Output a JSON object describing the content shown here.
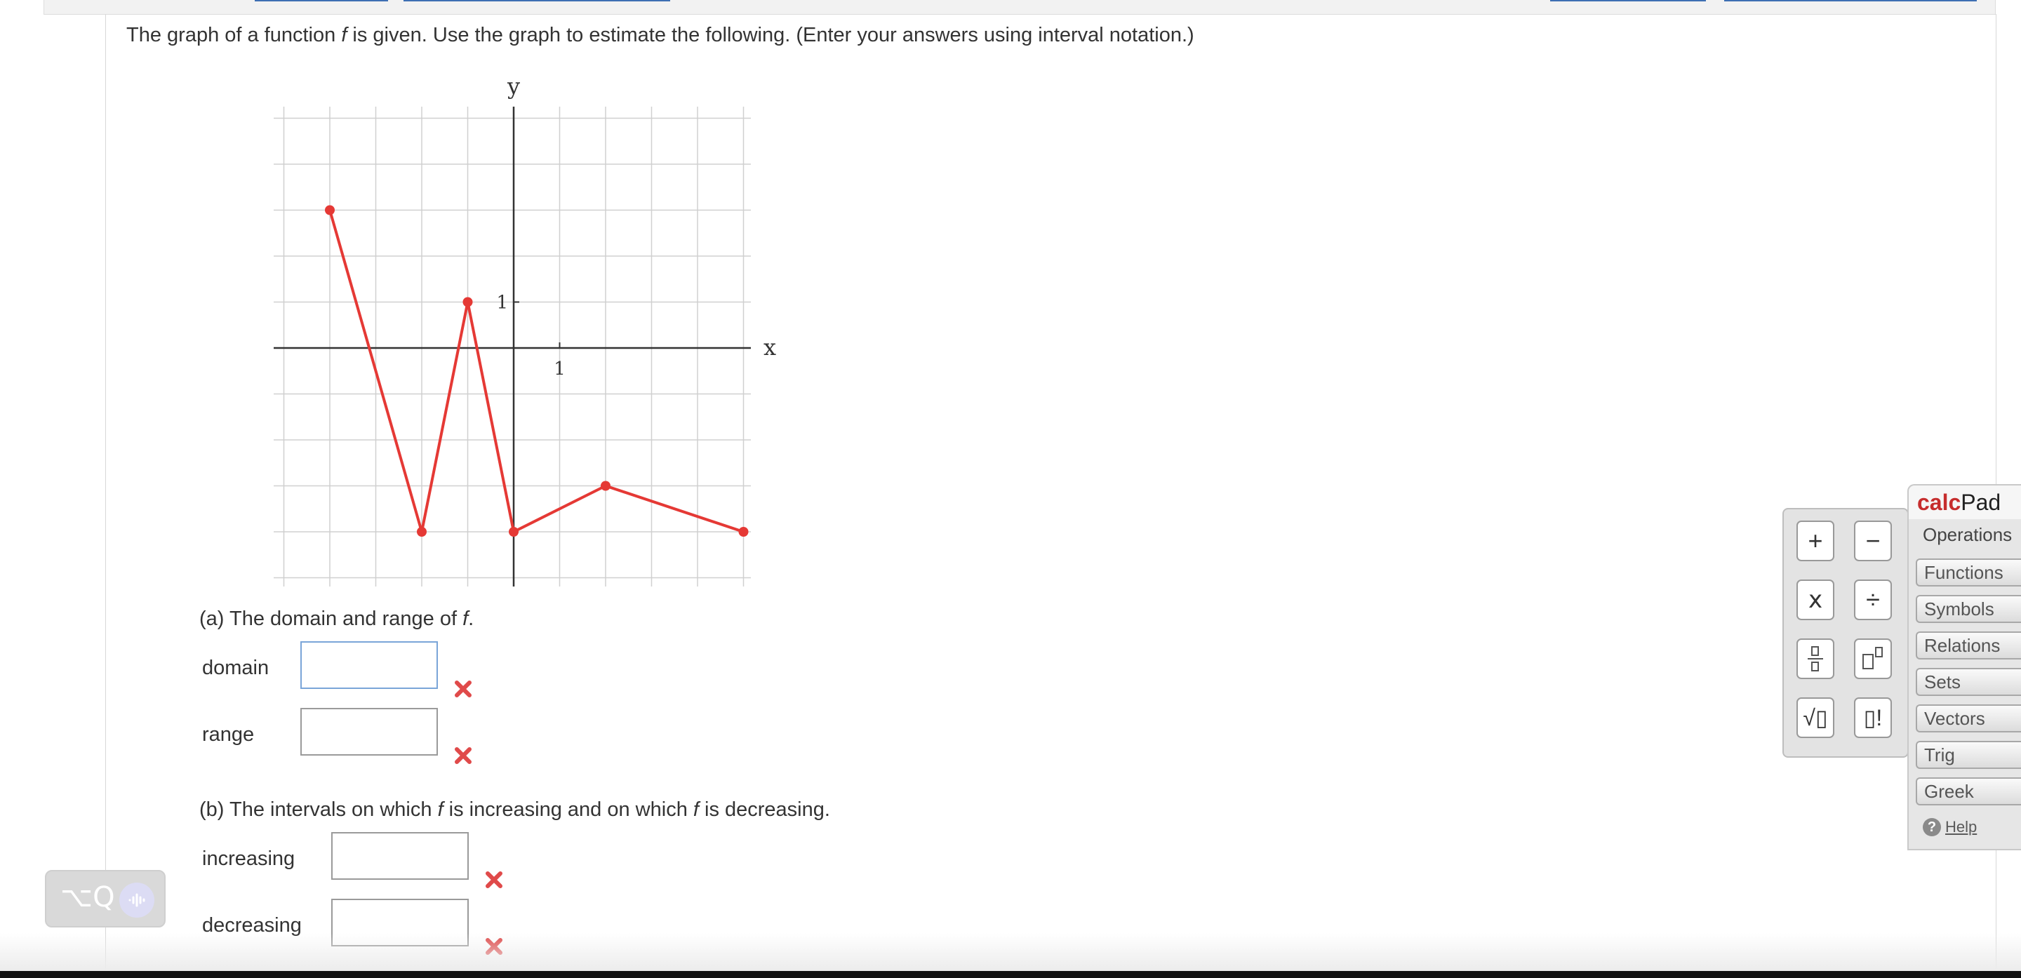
{
  "question": {
    "part1": "The graph of a function ",
    "f": "f",
    "part2": " is given. Use the graph to estimate the following. (Enter your answers using interval notation.)"
  },
  "graph": {
    "x_axis_label": "x",
    "y_axis_label": "y",
    "x_tick_label": "1",
    "y_tick_label": "1",
    "curve_color": "#e53935",
    "points": [
      [
        -4,
        3
      ],
      [
        -2,
        -4
      ],
      [
        -1,
        1
      ],
      [
        0,
        -4
      ],
      [
        2,
        -3
      ],
      [
        5,
        -4
      ]
    ],
    "closed_dots": [
      [
        -4,
        3
      ],
      [
        -2,
        -4
      ],
      [
        -1,
        1
      ],
      [
        0,
        -4
      ],
      [
        2,
        -3
      ],
      [
        5,
        -4
      ]
    ],
    "x_range": [
      -5,
      5
    ],
    "y_range": [
      -5,
      5
    ],
    "grid": true
  },
  "part_a": {
    "prefix": "(a) The domain and range of ",
    "f": "f",
    "suffix": ".",
    "domain_label": "domain",
    "range_label": "range",
    "domain_value": "",
    "range_value": ""
  },
  "part_b": {
    "prefix": "(b) The intervals on which ",
    "f1": "f",
    "middle": " is increasing and on which ",
    "f2": "f",
    "suffix": " is decreasing.",
    "increasing_label": "increasing",
    "decreasing_label": "decreasing",
    "increasing_value": "",
    "decreasing_value": ""
  },
  "status": {
    "wrong_icon": "x-mark-icon",
    "wrong_color": "#e04a4a"
  },
  "calcpad": {
    "title_part1": "calc",
    "title_part2": "Pad",
    "keys": [
      "+",
      "−",
      "x",
      "÷",
      "fraction",
      "power",
      "√▯",
      "▯!"
    ],
    "tabs": [
      "Operations",
      "Functions",
      "Symbols",
      "Relations",
      "Sets",
      "Vectors",
      "Trig",
      "Greek"
    ],
    "selected_tab": "Operations",
    "help_label": "Help"
  },
  "float_widget": {
    "shortcut": "⌥Q"
  }
}
